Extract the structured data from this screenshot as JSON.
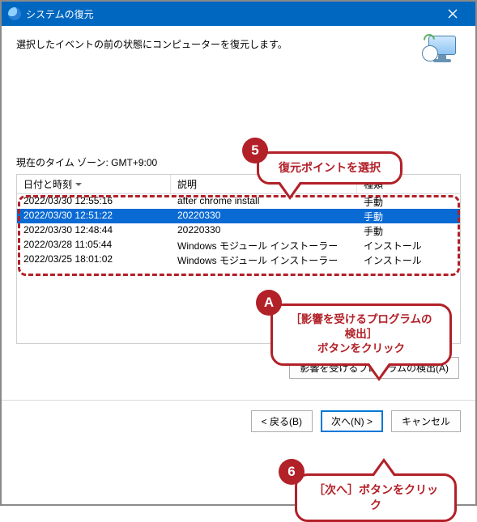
{
  "titlebar": {
    "title": "システムの復元"
  },
  "intro": "選択したイベントの前の状態にコンピューターを復元します。",
  "timezone_label": "現在のタイム ゾーン: GMT+9:00",
  "table": {
    "headers": {
      "date": "日付と時刻",
      "desc": "説明",
      "type": "種類"
    },
    "rows": [
      {
        "date": "2022/03/30 12:55:16",
        "desc": "after chrome install",
        "type": "手動",
        "selected": false
      },
      {
        "date": "2022/03/30 12:51:22",
        "desc": "20220330",
        "type": "手動",
        "selected": true
      },
      {
        "date": "2022/03/30 12:48:44",
        "desc": "20220330",
        "type": "手動",
        "selected": false
      },
      {
        "date": "2022/03/28 11:05:44",
        "desc": "Windows モジュール インストーラー",
        "type": "インストール",
        "selected": false
      },
      {
        "date": "2022/03/25 18:01:02",
        "desc": "Windows モジュール インストーラー",
        "type": "インストール",
        "selected": false
      }
    ]
  },
  "buttons": {
    "scan": "影響を受けるプログラムの検出(A)",
    "back": "< 戻る(B)",
    "next": "次へ(N) >",
    "cancel": "キャンセル"
  },
  "callouts": {
    "c5": {
      "badge": "5",
      "text": "復元ポイントを選択"
    },
    "cA": {
      "badge": "A",
      "line1": "［影響を受けるプログラムの検出］",
      "line2": "ボタンをクリック"
    },
    "c6": {
      "badge": "6",
      "text": "［次へ］ボタンをクリック"
    }
  }
}
